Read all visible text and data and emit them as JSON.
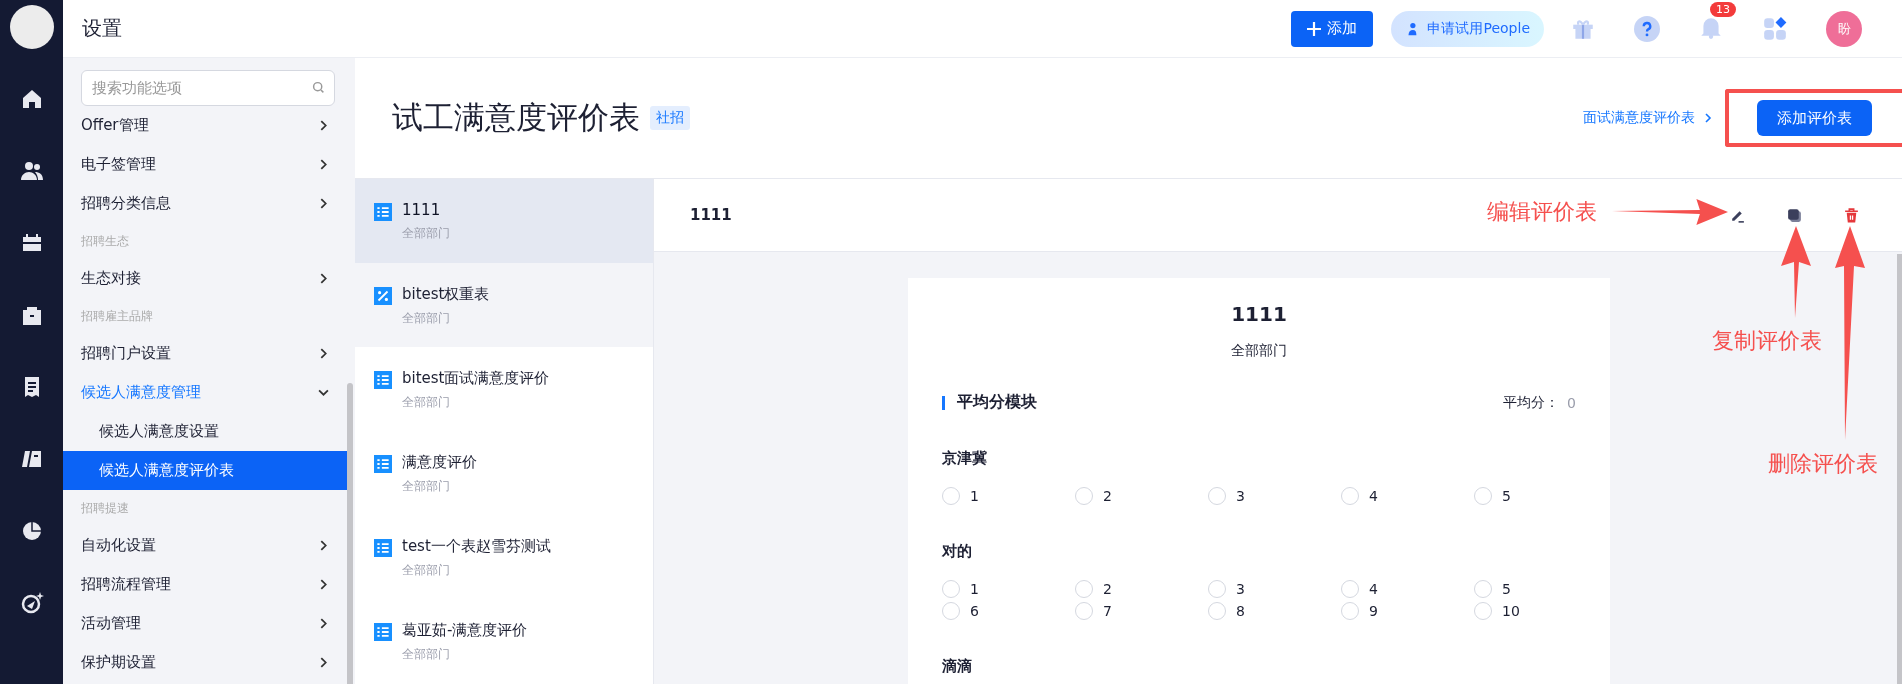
{
  "topbar": {
    "title": "设置",
    "add_button": "添加",
    "trial_button": "申请试用People",
    "notification_count": "13",
    "avatar": "盼"
  },
  "sidebar": {
    "search": {
      "placeholder": "搜索功能选项"
    },
    "items": [
      {
        "kind": "item",
        "label": "Offer管理",
        "selected": false
      },
      {
        "kind": "item",
        "label": "电子签管理",
        "selected": false
      },
      {
        "kind": "item",
        "label": "招聘分类信息",
        "selected": false
      },
      {
        "kind": "group",
        "label": "招聘生态"
      },
      {
        "kind": "item",
        "label": "生态对接",
        "selected": false
      },
      {
        "kind": "group",
        "label": "招聘雇主品牌"
      },
      {
        "kind": "item",
        "label": "招聘门户设置",
        "selected": false
      },
      {
        "kind": "item",
        "label": "候选人满意度管理",
        "selected": false,
        "expanded": true,
        "children": [
          {
            "kind": "item",
            "label": "候选人满意度设置",
            "selected": false
          },
          {
            "kind": "item",
            "label": "候选人满意度评价表",
            "selected": true
          }
        ]
      },
      {
        "kind": "group",
        "label": "招聘提速"
      },
      {
        "kind": "item",
        "label": "自动化设置",
        "selected": false
      },
      {
        "kind": "item",
        "label": "招聘流程管理",
        "selected": false
      },
      {
        "kind": "item",
        "label": "活动管理",
        "selected": false
      },
      {
        "kind": "item",
        "label": "保护期设置",
        "selected": false
      }
    ]
  },
  "page": {
    "title": "试工满意度评价表",
    "tag": "社招",
    "link": "面试满意度评价表",
    "add_button": "添加评价表"
  },
  "forms": [
    {
      "kind": "list",
      "name": "1111",
      "department": "全部部门",
      "selected": true,
      "hovered": false
    },
    {
      "kind": "weight",
      "name": "bitest权重表",
      "department": "全部部门",
      "selected": false,
      "hovered": true
    },
    {
      "kind": "list",
      "name": "bitest面试满意度评价",
      "department": "全部部门",
      "selected": false,
      "hovered": false
    },
    {
      "kind": "list",
      "name": "满意度评价",
      "department": "全部部门",
      "selected": false,
      "hovered": false
    },
    {
      "kind": "list",
      "name": "test一个表赵雪芬测试",
      "department": "全部部门",
      "selected": false,
      "hovered": false
    },
    {
      "kind": "list",
      "name": "葛亚茹-满意度评价",
      "department": "全部部门",
      "selected": false,
      "hovered": false
    }
  ],
  "detail": {
    "title": "1111",
    "preview": {
      "title": "1111",
      "department": "全部部门",
      "section": "平均分模块",
      "average_label": "平均分：",
      "average_value": "0",
      "questions": [
        {
          "label": "京津冀",
          "options": [
            "1",
            "2",
            "3",
            "4",
            "5"
          ]
        },
        {
          "label": "对的",
          "options": [
            "1",
            "2",
            "3",
            "4",
            "5",
            "6",
            "7",
            "8",
            "9",
            "10"
          ]
        },
        {
          "label": "滴滴"
        }
      ]
    }
  },
  "annotations": [
    {
      "kind": "edit",
      "text": "编辑评价表"
    },
    {
      "kind": "copy",
      "text": "复制评价表"
    },
    {
      "kind": "delete",
      "text": "删除评价表"
    }
  ]
}
